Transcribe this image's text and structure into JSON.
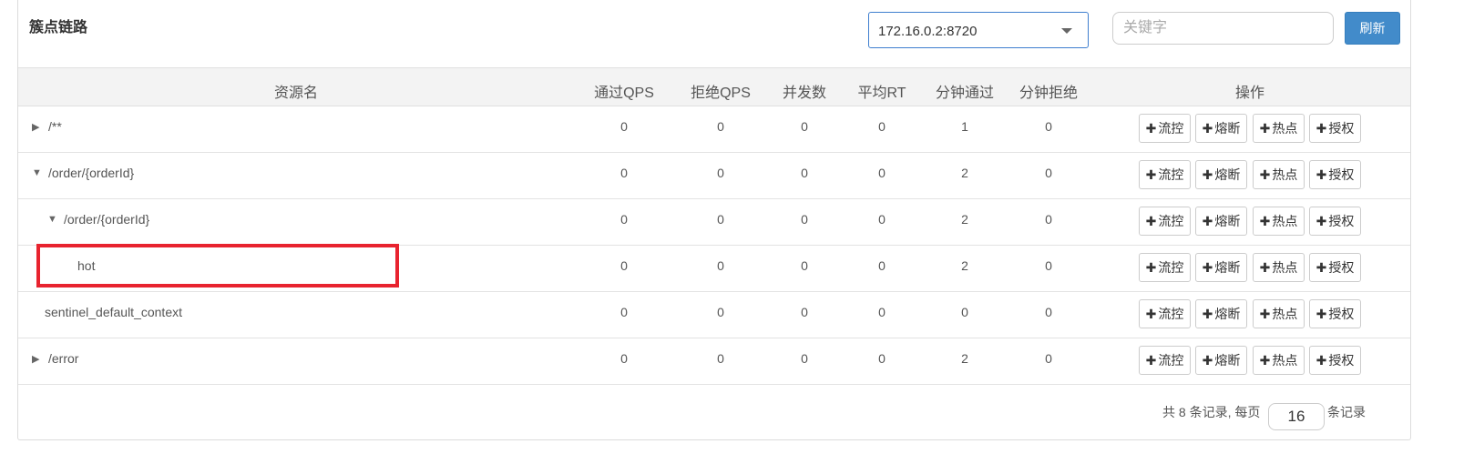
{
  "panel": {
    "title": "簇点链路",
    "machine_select": {
      "value": "172.16.0.2:8720"
    },
    "search": {
      "placeholder": "关键字"
    },
    "refresh_label": "刷新"
  },
  "table": {
    "headers": [
      "资源名",
      "通过QPS",
      "拒绝QPS",
      "并发数",
      "平均RT",
      "分钟通过",
      "分钟拒绝",
      "操作"
    ],
    "action_labels": [
      "流控",
      "熔断",
      "热点",
      "授权"
    ],
    "rows": [
      {
        "toggle": "▶",
        "name": "/**",
        "values": [
          "0",
          "0",
          "0",
          "0",
          "1",
          "0"
        ]
      },
      {
        "toggle": "▼",
        "name": "/order/{orderId}",
        "values": [
          "0",
          "0",
          "0",
          "0",
          "2",
          "0"
        ]
      },
      {
        "toggle": "▼",
        "name": "/order/{orderId}",
        "values": [
          "0",
          "0",
          "0",
          "0",
          "2",
          "0"
        ]
      },
      {
        "toggle": "",
        "name": "hot",
        "values": [
          "0",
          "0",
          "0",
          "0",
          "2",
          "0"
        ]
      },
      {
        "toggle": "",
        "name": "sentinel_default_context",
        "values": [
          "0",
          "0",
          "0",
          "0",
          "0",
          "0"
        ]
      },
      {
        "toggle": "▶",
        "name": "/error",
        "values": [
          "0",
          "0",
          "0",
          "0",
          "2",
          "0"
        ]
      }
    ]
  },
  "pagination": {
    "prefix": "共 8 条记录, 每页",
    "page_size": "16",
    "suffix": "条记录"
  },
  "colors": {
    "primary": "#428bca",
    "highlight": "#e8232f"
  }
}
